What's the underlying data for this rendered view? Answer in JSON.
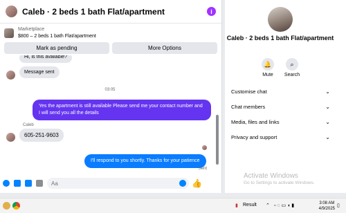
{
  "chat": {
    "title": "Caleb · 2 beds 1 bath Flat/apartment",
    "marketplace_label": "Marketplace",
    "listing": "$800 – 2 beds 1 bath Flat/apartment",
    "mark_pending": "Mark as pending",
    "more_options": "More Options"
  },
  "messages": {
    "partial_in": "Hi, is this available?",
    "sent_auto": "Message sent",
    "time": "03:05",
    "out_1": "Yes the apartment is still available Please send me your contact number and I will send you all the details",
    "sender": "Caleb",
    "in_phone": "605-251-9603",
    "out_2": "I'll respond to you shortly. Thanks for your patience",
    "status": "Sent"
  },
  "composer": {
    "placeholder": "Aa"
  },
  "info": {
    "name": "Caleb · 2 beds 1 bath Flat/apartment",
    "mute": "Mute",
    "search": "Search",
    "rows": [
      "Customise chat",
      "Chat members",
      "Media, files and links",
      "Privacy and support"
    ]
  },
  "watermark": {
    "title": "Activate Windows",
    "subtitle": "Go to Settings to activate Windows."
  },
  "taskbar": {
    "result": "Result",
    "time": "3:08 AM",
    "date": "4/9/2025"
  },
  "colors": {
    "outgoing": "#6434f0",
    "accent": "#0084ff",
    "info": "#a033ff"
  }
}
